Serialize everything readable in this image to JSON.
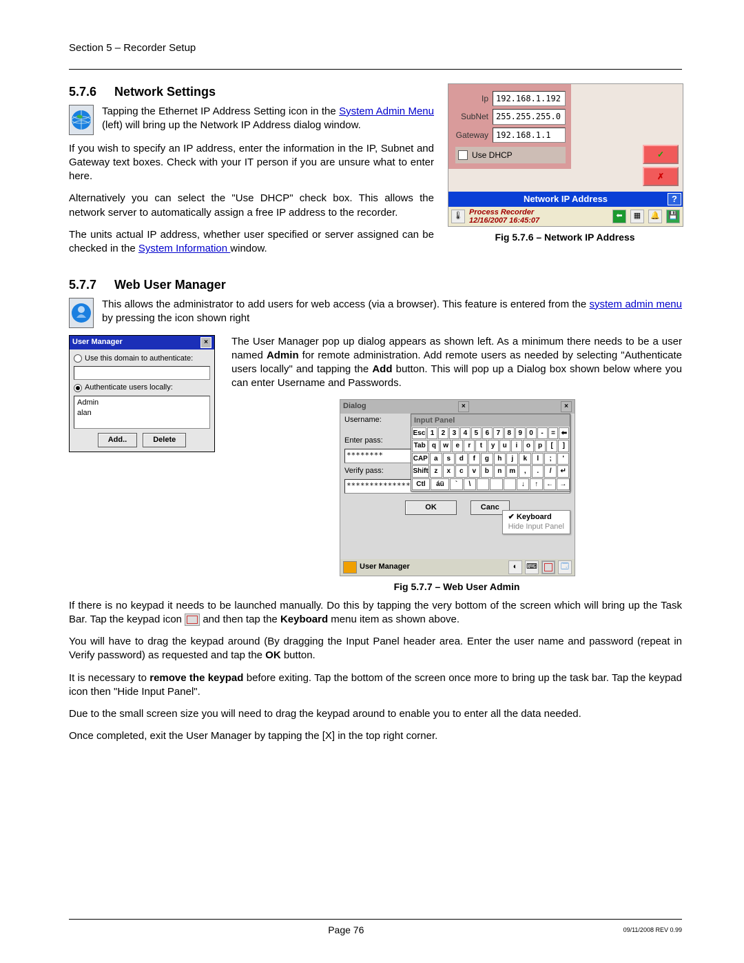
{
  "header": "Section 5 – Recorder Setup",
  "s576": {
    "num": "5.7.6",
    "title": "Network Settings",
    "p1a": "Tapping the Ethernet IP Address Setting icon in the ",
    "p1b": "System Admin Menu",
    "p1c": " (left) will bring up the Network IP Address dialog window.",
    "p2": "If you wish to specify an IP address, enter the information in the IP, Subnet and Gateway text boxes. Check with your IT person if you are unsure what to enter here.",
    "p3": "Alternatively you can select the \"Use DHCP\" check box. This allows the network server to automatically assign a free IP address to the recorder.",
    "p4a": "The units actual IP address, whether user specified or server assigned can be checked in the ",
    "p4b": "System Information ",
    "p4c": "window.",
    "fig_cap": "Fig 5.7.6 – Network IP Address",
    "net": {
      "ip_l": "Ip",
      "ip_v": "192.168.1.192",
      "sn_l": "SubNet",
      "sn_v": "255.255.255.0",
      "gw_l": "Gateway",
      "gw_v": "192.168.1.1",
      "dhcp": "Use DHCP",
      "bar": "Network IP Address",
      "help": "?",
      "stat1": "Process Recorder",
      "stat2": "12/16/2007 16:45:07",
      "ok": "✓",
      "cancel": "✗"
    }
  },
  "s577": {
    "num": "5.7.7",
    "title": "Web User Manager",
    "p1a": "This allows the administrator to add users for web access (via a browser). This feature is entered from the ",
    "p1b": "system admin menu",
    "p1c": " by pressing the icon shown right",
    "p2a": "The User Manager pop up dialog appears as shown left. As a minimum there needs to be a user named ",
    "p2b": "Admin",
    "p2c": " for remote administration. Add remote users as needed by selecting \"Authenticate users locally\" and tapping the ",
    "p2d": "Add",
    "p2e": " button. This will pop up a Dialog box shown below where you can enter Username and Passwords.",
    "um": {
      "title": "User Manager",
      "x": "×",
      "opt1": "Use this domain to authenticate:",
      "opt2": "Authenticate users locally:",
      "u1": "Admin",
      "u2": "alan",
      "add": "Add..",
      "del": "Delete"
    },
    "dlg": {
      "title": "Dialog",
      "x": "×",
      "un_l": "Username:",
      "ep_l": "Enter pass:",
      "vp_l": "Verify pass:",
      "ep_v": "********",
      "vp_v": "****************",
      "ok": "OK",
      "cancel": "Canc",
      "ip_title": "Input Panel",
      "kb_rows": [
        [
          "Esc",
          "1",
          "2",
          "3",
          "4",
          "5",
          "6",
          "7",
          "8",
          "9",
          "0",
          "-",
          "=",
          "⬅"
        ],
        [
          "Tab",
          "q",
          "w",
          "e",
          "r",
          "t",
          "y",
          "u",
          "i",
          "o",
          "p",
          "[",
          "]"
        ],
        [
          "CAP",
          "a",
          "s",
          "d",
          "f",
          "g",
          "h",
          "j",
          "k",
          "l",
          ";",
          "'"
        ],
        [
          "Shift",
          "z",
          "x",
          "c",
          "v",
          "b",
          "n",
          "m",
          ",",
          ".",
          "/",
          "↵"
        ],
        [
          "Ctl",
          "áü",
          "`",
          "\\",
          " ",
          " ",
          " ",
          "↓",
          "↑",
          "←",
          "→"
        ]
      ],
      "pop1": "✔ Keyboard",
      "pop2": "Hide Input Panel",
      "task": "User Manager"
    },
    "fig_cap": "Fig 5.7.7 – Web User Admin"
  },
  "s578": {
    "p1a": "If there is no keypad it needs to be launched manually. Do this by tapping the very bottom of the screen which will bring up the Task Bar. Tap the keypad icon ",
    "p1b": " and then tap the ",
    "p1c": "Keyboard",
    "p1d": " menu item as shown above.",
    "p2a": "You will have to drag the keypad around (By dragging the Input Panel header area. Enter the user name and password (repeat in Verify password) as requested and tap the ",
    "p2b": "OK",
    "p2c": " button.",
    "p3a": "It is necessary to ",
    "p3b": "remove the keypad",
    "p3c": " before exiting. Tap the bottom of the screen once more to bring up the task bar. Tap the keypad icon then \"Hide Input Panel\".",
    "p4": "Due to the small screen size you will need to drag the keypad around to enable you to enter all the data needed.",
    "p5": "Once completed, exit the User Manager by tapping the [X] in the top right corner."
  },
  "footer": {
    "page": "Page 76",
    "rev": "09/11/2008 REV 0.99"
  }
}
